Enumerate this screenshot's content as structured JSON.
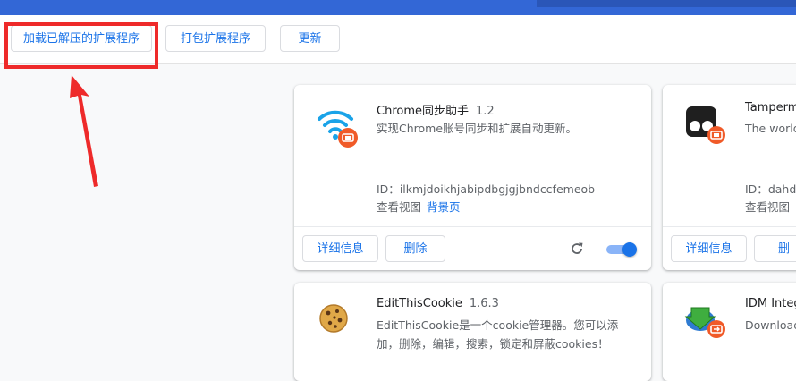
{
  "toolbar": {
    "load_unpacked": "加载已解压的扩展程序",
    "pack_extension": "打包扩展程序",
    "update": "更新"
  },
  "extensions": [
    {
      "name": "Chrome同步助手",
      "version": "1.2",
      "description": "实现Chrome账号同步和扩展自动更新。",
      "id_label": "ID：",
      "id": "ilkmjdoikhjabipdbgjgjbndccfemeob",
      "views_label": "查看视图",
      "views_link": "背景页",
      "details": "详细信息",
      "remove": "删除",
      "enabled": true
    },
    {
      "name": "Tamperm",
      "description": "The world",
      "id_label": "ID：",
      "id": "dahdb",
      "views_label": "查看视图",
      "details": "详细信息",
      "remove": "删"
    },
    {
      "name": "EditThisCookie",
      "version": "1.6.3",
      "description_line1": "EditThisCookie是一个cookie管理器。您可以添",
      "description_line2": "加，删除，编辑，搜索，锁定和屏蔽cookies！"
    },
    {
      "name": "IDM Integ",
      "description": "Download"
    }
  ],
  "colors": {
    "accent": "#1a73e8",
    "topbar": "#3367d6",
    "highlight": "#ee2a2a"
  },
  "icons": {
    "wifi": "wifi-icon",
    "tampermonkey": "tampermonkey-icon",
    "cookie": "cookie-icon",
    "idm": "idm-icon",
    "reload": "reload-icon"
  }
}
